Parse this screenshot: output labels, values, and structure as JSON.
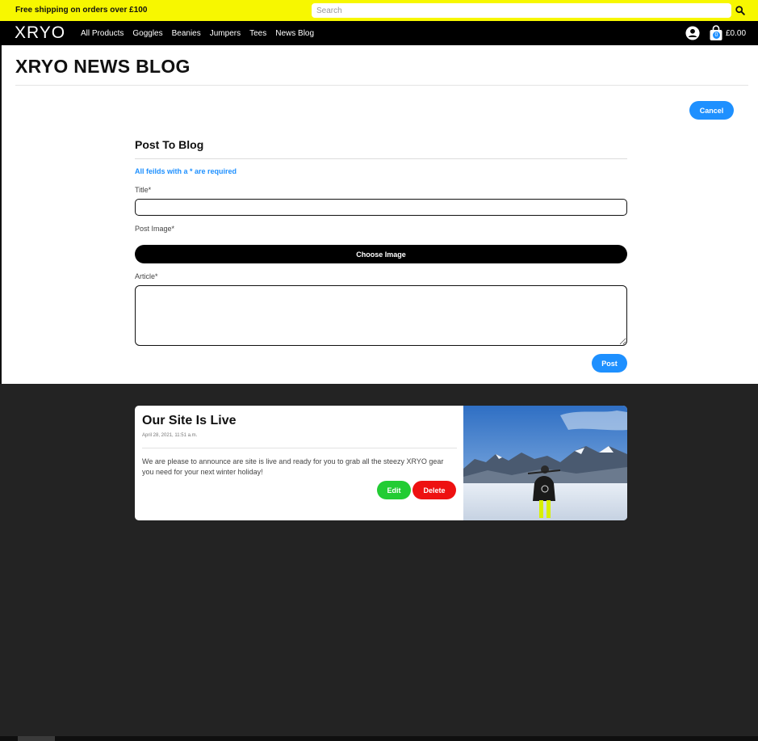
{
  "promo": {
    "text": "Free shipping on orders over £100"
  },
  "search": {
    "placeholder": "Search"
  },
  "nav": {
    "logo": "XRYO",
    "links": [
      "All Products",
      "Goggles",
      "Beanies",
      "Jumpers",
      "Tees",
      "News Blog"
    ],
    "cart_count": "0",
    "cart_total": "£0.00"
  },
  "page": {
    "title": "XRYO NEWS BLOG",
    "cancel_label": "Cancel"
  },
  "form": {
    "heading": "Post To Blog",
    "required_note": "All feilds with a * are required",
    "title_label": "Title*",
    "title_value": "",
    "image_label": "Post Image*",
    "choose_image_label": "Choose Image",
    "article_label": "Article*",
    "article_value": "",
    "post_label": "Post"
  },
  "post": {
    "title": "Our Site Is Live",
    "date": "April 28, 2021, 11:51 a.m.",
    "body": "We are please to announce are site is live and ready for you to grab all the steezy XRYO gear you need for your next winter holiday!",
    "edit_label": "Edit",
    "delete_label": "Delete"
  },
  "colors": {
    "promo_bg": "#f7f700",
    "accent": "#1e90ff",
    "edit": "#22cc33",
    "delete": "#ee1111",
    "dark_bg": "#232323"
  }
}
